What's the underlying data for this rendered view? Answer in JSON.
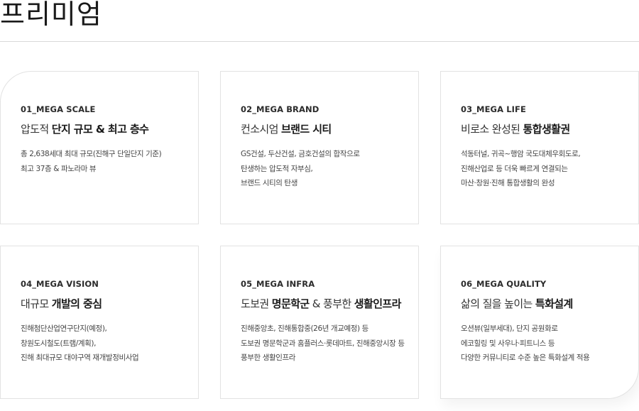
{
  "page": {
    "title": "프리미엄"
  },
  "cards": [
    {
      "code": "01_MEGA SCALE",
      "headline_plain": "압도적 ",
      "headline_strong": "단지 규모 & 최고 층수",
      "headline_after": "",
      "desc": [
        "총 2,638세대 최대 규모(진해구 단일단지 기준)",
        "최고 37층 & 파노라마 뷰"
      ]
    },
    {
      "code": "02_MEGA BRAND",
      "headline_plain": "컨소시엄 ",
      "headline_strong": "브랜드 시티",
      "headline_after": "",
      "desc": [
        "GS건설, 두산건설, 금호건설의 합작으로",
        "탄생하는 압도적 자부심,",
        "브랜드 시티의 탄생"
      ]
    },
    {
      "code": "03_MEGA LIFE",
      "headline_plain": "비로소 완성된 ",
      "headline_strong": "통합생활권",
      "headline_after": "",
      "desc": [
        "석동터널, 귀곡~행암 국도대체우회도로,",
        "진해산업로 등 더욱 빠르게 연결되는",
        "마산·창원·진해 통합생활의 완성"
      ]
    },
    {
      "code": "04_MEGA VISION",
      "headline_plain": "대규모 ",
      "headline_strong": "개발의 중심",
      "headline_after": "",
      "desc": [
        "진해첨단산업연구단지(예정),",
        "창원도시철도(트램/계획),",
        "진해 최대규모 대야구역 재개발정비사업"
      ]
    },
    {
      "code": "05_MEGA INFRA",
      "headline_plain": "도보권 ",
      "headline_strong": "명문학군",
      "headline_mid": " & 풍부한 ",
      "headline_after": "생활인프라",
      "desc": [
        "진해중앙초, 진해통합중(26년 개교예정) 등",
        "도보권 명문학군과 홈플러스·롯데마트, 진해중앙시장 등",
        "풍부한 생활인프라"
      ]
    },
    {
      "code": "06_MEGA QUALITY",
      "headline_plain": "삶의 질을 높이는 ",
      "headline_strong": "특화설계",
      "headline_after": "",
      "desc": [
        "오션뷰(일부세대), 단지 공원화로",
        "에코힐링 및 사우나·피트니스 등",
        "다양한 커뮤니티로 수준 높은 특화설계 적용"
      ]
    }
  ]
}
